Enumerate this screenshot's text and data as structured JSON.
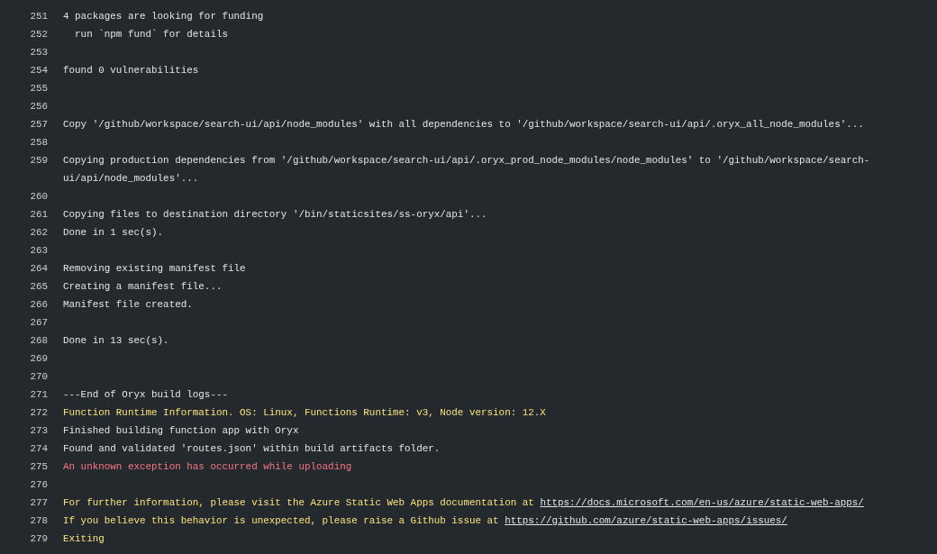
{
  "log_lines": [
    {
      "number": "251",
      "text": "4 packages are looking for funding",
      "kind": "plain"
    },
    {
      "number": "252",
      "text": "  run `npm fund` for details",
      "kind": "plain"
    },
    {
      "number": "253"
    },
    {
      "number": "254",
      "text": "found 0 vulnerabilities",
      "kind": "plain"
    },
    {
      "number": "255"
    },
    {
      "number": "256"
    },
    {
      "number": "257",
      "text": "Copy '/github/workspace/search-ui/api/node_modules' with all dependencies to '/github/workspace/search-ui/api/.oryx_all_node_modules'...",
      "kind": "plain"
    },
    {
      "number": "258"
    },
    {
      "number": "259",
      "text": "Copying production dependencies from '/github/workspace/search-ui/api/.oryx_prod_node_modules/node_modules' to '/github/workspace/search-ui/api/node_modules'...",
      "kind": "plain"
    },
    {
      "number": "260"
    },
    {
      "number": "261",
      "text": "Copying files to destination directory '/bin/staticsites/ss-oryx/api'...",
      "kind": "plain"
    },
    {
      "number": "262",
      "text": "Done in 1 sec(s).",
      "kind": "plain"
    },
    {
      "number": "263"
    },
    {
      "number": "264",
      "text": "Removing existing manifest file",
      "kind": "plain"
    },
    {
      "number": "265",
      "text": "Creating a manifest file...",
      "kind": "plain"
    },
    {
      "number": "266",
      "text": "Manifest file created.",
      "kind": "plain"
    },
    {
      "number": "267"
    },
    {
      "number": "268",
      "text": "Done in 13 sec(s).",
      "kind": "plain"
    },
    {
      "number": "269"
    },
    {
      "number": "270"
    },
    {
      "number": "271",
      "text": "---End of Oryx build logs---",
      "kind": "plain"
    },
    {
      "number": "272",
      "text": "Function Runtime Information. OS: Linux, Functions Runtime: v3, Node version: 12.X",
      "kind": "warning"
    },
    {
      "number": "273",
      "text": "Finished building function app with Oryx",
      "kind": "plain"
    },
    {
      "number": "274",
      "text": "Found and validated 'routes.json' within build artifacts folder.",
      "kind": "plain"
    },
    {
      "number": "275",
      "text": "An unknown exception has occurred while uploading",
      "kind": "error"
    },
    {
      "number": "276"
    },
    {
      "number": "277",
      "text": "For further information, please visit the Azure Static Web Apps documentation at ",
      "link": "https://docs.microsoft.com/en-us/azure/static-web-apps/",
      "kind": "warning"
    },
    {
      "number": "278",
      "text": "If you believe this behavior is unexpected, please raise a Github issue at ",
      "link": "https://github.com/azure/static-web-apps/issues/",
      "kind": "warning"
    },
    {
      "number": "279",
      "text": "Exiting",
      "kind": "warning"
    }
  ]
}
